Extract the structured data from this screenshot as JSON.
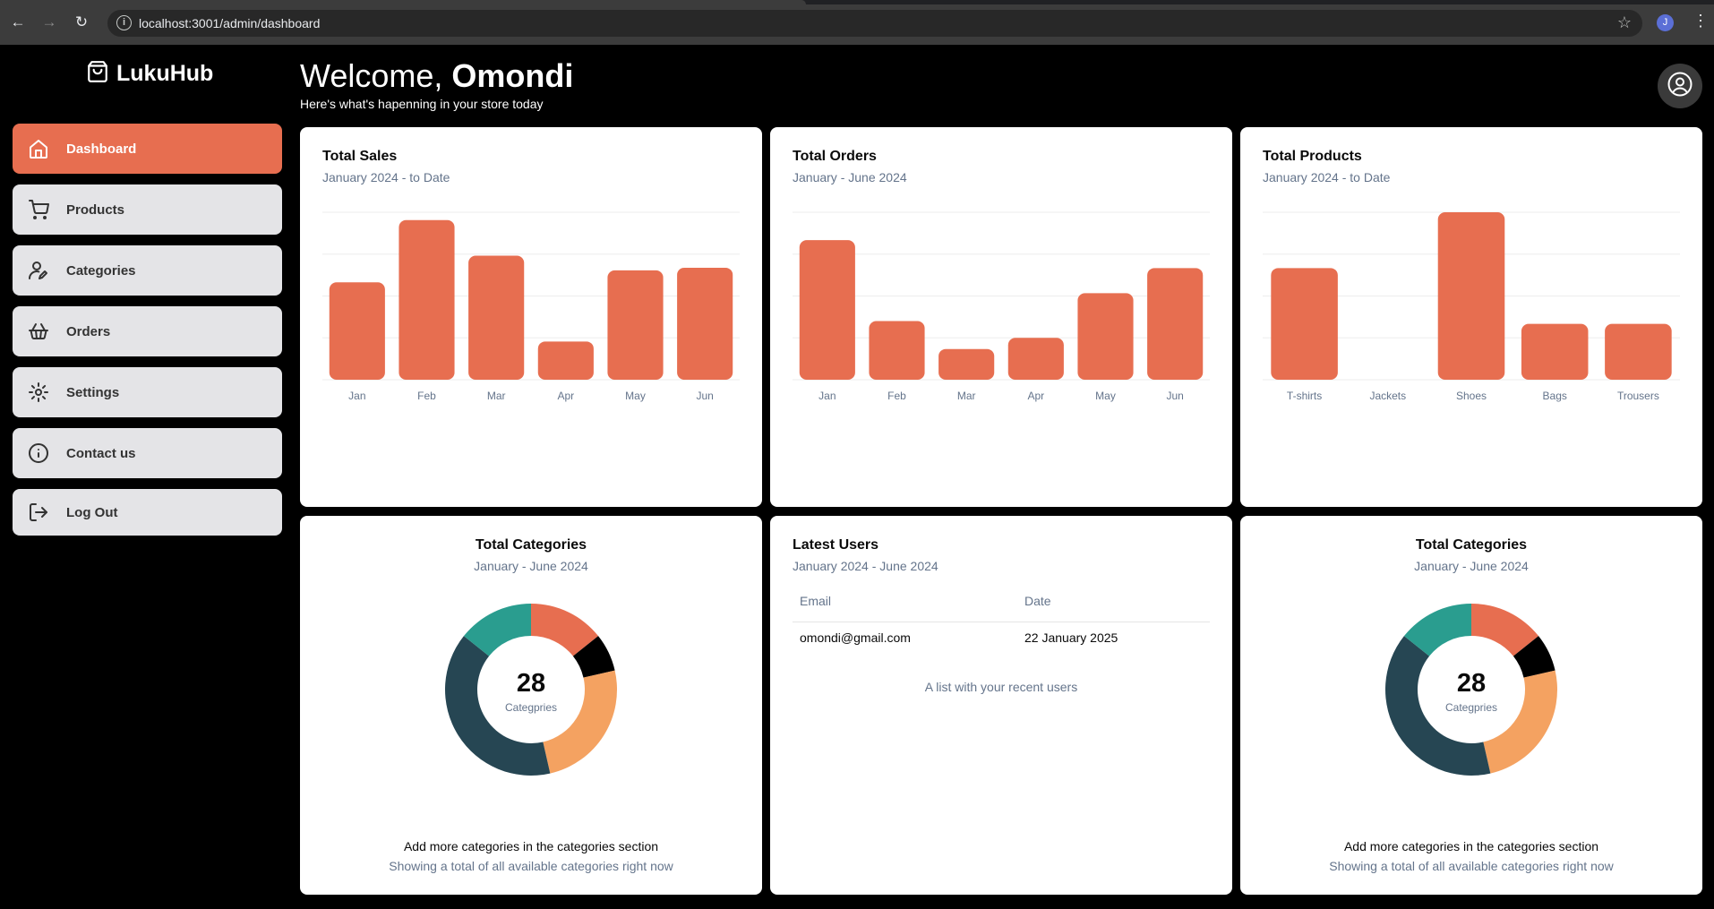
{
  "browser": {
    "url": "localhost:3001/admin/dashboard",
    "profile_initial": "J"
  },
  "brand": {
    "name": "LukuHub",
    "icon": "shopping-bag-icon"
  },
  "sidebar": {
    "items": [
      {
        "label": "Dashboard",
        "icon": "home-icon",
        "active": true
      },
      {
        "label": "Products",
        "icon": "cart-icon",
        "active": false
      },
      {
        "label": "Categories",
        "icon": "user-edit-icon",
        "active": false
      },
      {
        "label": "Orders",
        "icon": "basket-icon",
        "active": false
      },
      {
        "label": "Settings",
        "icon": "gear-icon",
        "active": false
      },
      {
        "label": "Contact us",
        "icon": "info-icon",
        "active": false
      },
      {
        "label": "Log Out",
        "icon": "logout-icon",
        "active": false
      }
    ]
  },
  "header": {
    "greeting": "Welcome, ",
    "name": "Omondi",
    "subtitle": "Here's what's hapenning in your store today"
  },
  "colors": {
    "accent": "#e76e50",
    "teal": "#2a9d8f",
    "navy": "#264653",
    "sand": "#f4a261",
    "black": "#000000"
  },
  "cards": {
    "sales": {
      "title": "Total Sales",
      "desc": "January 2024 - to Date"
    },
    "orders": {
      "title": "Total Orders",
      "desc": "January - June 2024"
    },
    "products": {
      "title": "Total Products",
      "desc": "January 2024 - to Date"
    },
    "categories_left": {
      "title": "Total Categories",
      "desc": "January - June 2024",
      "center_value": "28",
      "center_label": "Categpries",
      "footer_main": "Add more categories in the categories section",
      "footer_sub": "Showing a total of all available categories right now"
    },
    "users": {
      "title": "Latest Users",
      "desc": "January 2024 - June 2024",
      "columns": [
        "Email",
        "Date"
      ],
      "rows": [
        {
          "email": "omondi@gmail.com",
          "date": "22 January 2025"
        }
      ],
      "caption": "A list with your recent users"
    },
    "categories_right": {
      "title": "Total Categories",
      "desc": "January - June 2024",
      "center_value": "28",
      "center_label": "Categpries",
      "footer_main": "Add more categories in the categories section",
      "footer_sub": "Showing a total of all available categories right now"
    }
  },
  "chart_data": [
    {
      "type": "bar",
      "title": "Total Sales",
      "categories": [
        "Jan",
        "Feb",
        "Mar",
        "Apr",
        "May",
        "Jun"
      ],
      "values": [
        186,
        305,
        237,
        73,
        209,
        214
      ],
      "ylim": [
        0,
        320
      ],
      "grid": true
    },
    {
      "type": "bar",
      "title": "Total Orders",
      "categories": [
        "Jan",
        "Feb",
        "Mar",
        "Apr",
        "May",
        "Jun"
      ],
      "values": [
        100,
        42,
        22,
        30,
        62,
        80
      ],
      "ylim": [
        0,
        120
      ],
      "grid": true
    },
    {
      "type": "bar",
      "title": "Total Products",
      "categories": [
        "T-shirts",
        "Jackets",
        "Shoes",
        "Bags",
        "Trousers"
      ],
      "values": [
        8,
        0,
        12,
        4,
        4
      ],
      "ylim": [
        0,
        12
      ],
      "grid": true
    },
    {
      "type": "pie",
      "title": "Total Categories",
      "slices": [
        {
          "value": 4,
          "color": "#e76e50"
        },
        {
          "value": 2,
          "color": "#000000"
        },
        {
          "value": 7,
          "color": "#f4a261"
        },
        {
          "value": 11,
          "color": "#264653"
        },
        {
          "value": 4,
          "color": "#2a9d8f"
        }
      ],
      "total": 28
    },
    {
      "type": "pie",
      "title": "Total Categories",
      "slices": [
        {
          "value": 4,
          "color": "#e76e50"
        },
        {
          "value": 2,
          "color": "#000000"
        },
        {
          "value": 7,
          "color": "#f4a261"
        },
        {
          "value": 11,
          "color": "#264653"
        },
        {
          "value": 4,
          "color": "#2a9d8f"
        }
      ],
      "total": 28
    }
  ]
}
